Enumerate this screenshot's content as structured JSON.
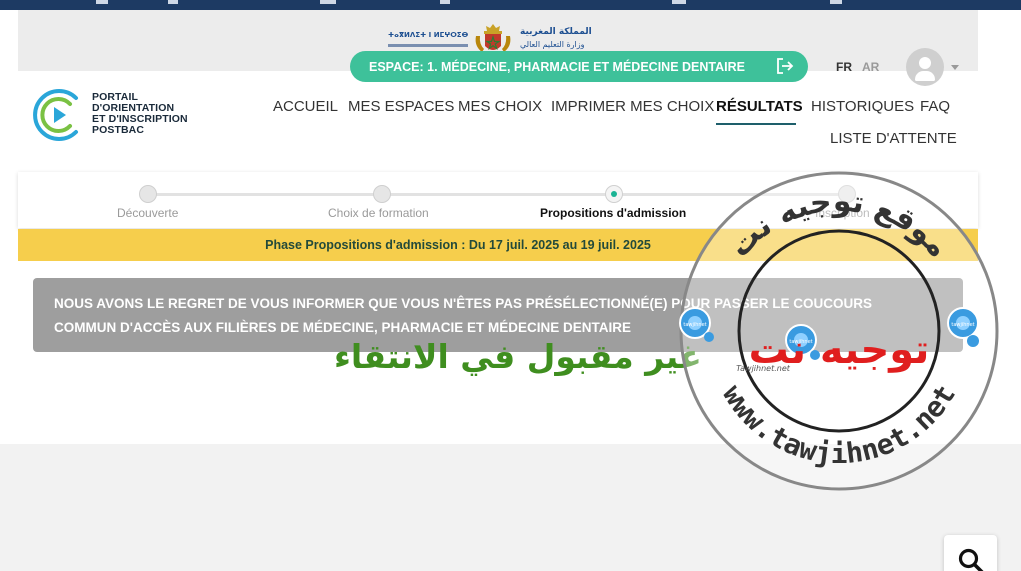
{
  "ministry": {
    "tifinagh": "ⵜⴰⴳⵍⴷⵉⵜ ⵏ ⵍⵎⵖⵔⵉⴱ",
    "arabic_title": "المملكة المغربية",
    "arabic_subtitle": "وزارة التعليم العالي"
  },
  "espace": {
    "label": "ESPACE: 1. MÉDECINE, PHARMACIE ET MÉDECINE DENTAIRE",
    "exit_icon": "logout-icon"
  },
  "language": {
    "fr": "FR",
    "ar": "AR"
  },
  "logo": {
    "lines": [
      "PORTAIL",
      "D'ORIENTATION",
      "ET D'INSCRIPTION",
      "POSTBAC"
    ]
  },
  "nav": {
    "items": [
      {
        "label": "ACCUEIL"
      },
      {
        "label": "MES ESPACES"
      },
      {
        "label": "MES CHOIX"
      },
      {
        "label": "IMPRIMER MES CHOIX"
      },
      {
        "label": "RÉSULTATS"
      },
      {
        "label": "HISTORIQUES"
      },
      {
        "label": "FAQ"
      },
      {
        "label": "LISTE D'ATTENTE"
      }
    ],
    "active": "RÉSULTATS"
  },
  "stepper": {
    "steps": [
      {
        "label": "Découverte"
      },
      {
        "label": "Choix de formation"
      },
      {
        "label": "Propositions d'admission"
      },
      {
        "label": "Inscription"
      }
    ],
    "current_index": 2
  },
  "phase": {
    "text": "Phase Propositions d'admission : Du 17 juil. 2025 au 19 juil. 2025"
  },
  "alert": {
    "line1": "NOUS AVONS LE REGRET DE VOUS INFORMER QUE VOUS N'ÊTES PAS PRÉSÉLECTIONNÉ(E) POUR PASSER LE COUCOURS",
    "line2": "COMMUN D'ACCÈS AUX FILIÈRES DE MÉDECINE, PHARMACIE ET MÉDECINE DENTAIRE"
  },
  "overlay_caption": "غير مقبول في الانتقاء",
  "watermark": {
    "arc_top": "موقع توجيه نت",
    "arc_bottom": "www.tawjihnet.net",
    "brand": "توجيه نت",
    "brand_sub": "Tawjihnet.net",
    "badge": "tawjihnet"
  },
  "colors": {
    "header_bar": "#1d3a63",
    "accent_green": "#3ec19a",
    "active_underline": "#1e5f6b",
    "phase_yellow": "#f6ce4c",
    "alert_gray": "#9e9e9e",
    "caption_green": "#3f8e1f",
    "watermark_red": "#e01e1e",
    "watermark_blue": "#3a9be0"
  },
  "search": {
    "icon": "search-icon"
  }
}
